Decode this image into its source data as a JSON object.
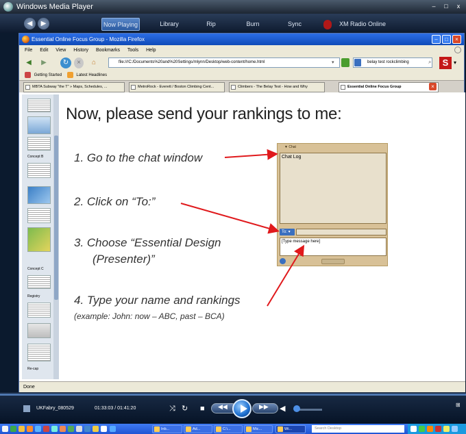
{
  "wmp": {
    "title": "Windows Media Player",
    "tabs": [
      "Now Playing",
      "Library",
      "Rip",
      "Burn",
      "Sync",
      "XM Radio Online"
    ],
    "media_name": "UKFabry_080529",
    "time": "01:33:03 / 01:41:20",
    "window_controls": [
      "–",
      "□",
      "x"
    ]
  },
  "firefox": {
    "title": "Essential Online Focus Group - Mozilla Firefox",
    "menu": [
      "File",
      "Edit",
      "View",
      "History",
      "Bookmarks",
      "Tools",
      "Help"
    ],
    "url": "file:///C:/Documents%20and%20Settings/mlynn/Desktop/web-content/home.html",
    "search": "belay test rockclimbing",
    "bookmarks": [
      "Getting Started",
      "Latest Headlines"
    ],
    "tabs": [
      "MBTA Subway \"the T\" » Maps, Schedules, ...",
      "MetroRock - Everett / Boston Climbing Cent...",
      "Climbers - The Belay Test - How and Why",
      "Essential Online Focus Group"
    ],
    "status": "Done"
  },
  "sidebar": {
    "labels": [
      "Concept B",
      "Concept C",
      "Registry",
      "Re-cap"
    ]
  },
  "slide": {
    "title": "Now, please send your rankings to me:",
    "steps": [
      "1.   Go to the chat window",
      "2.   Click on “To:”",
      "3.   Choose “Essential Design",
      "(Presenter)”",
      "4.   Type your name and rankings"
    ],
    "example": "(example: John: now – ABC, past – BCA)"
  },
  "chat": {
    "header": "▼ Chat",
    "log_label": "Chat Log",
    "to_label": "To: ▾",
    "message_placeholder": "[Type message here]"
  },
  "taskbar": {
    "tasks": [
      "Inb...",
      "Ad...",
      "C:\\...",
      "Mic...",
      "Wi..."
    ],
    "search_placeholder": "Search Desktop"
  },
  "colors": {
    "arrow": "#e0191c",
    "chat_bg": "#d8c197",
    "xp_title": "#0f4bb8"
  }
}
